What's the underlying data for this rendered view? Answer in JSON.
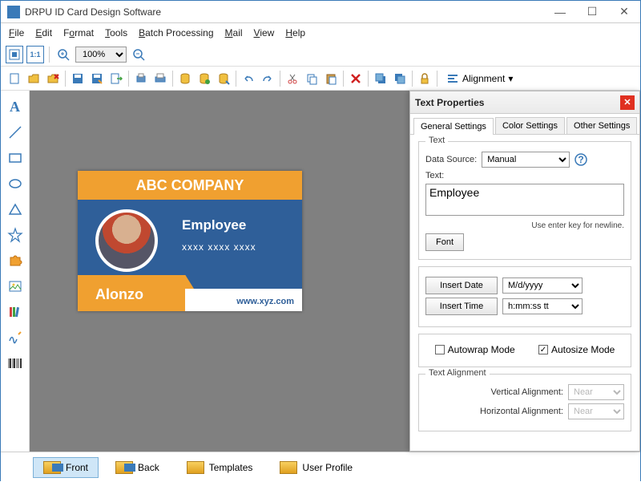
{
  "window": {
    "title": "DRPU ID Card Design Software"
  },
  "menu": [
    "File",
    "Edit",
    "Format",
    "Tools",
    "Batch Processing",
    "Mail",
    "View",
    "Help"
  ],
  "zoom": "100%",
  "alignment_label": "Alignment",
  "card": {
    "company": "ABC COMPANY",
    "role": "Employee",
    "masked": "xxxx xxxx xxxx",
    "name": "Alonzo",
    "website": "www.xyz.com"
  },
  "props": {
    "title": "Text Properties",
    "tabs": [
      "General Settings",
      "Color Settings",
      "Other Settings"
    ],
    "text_group": "Text",
    "data_source_label": "Data Source:",
    "data_source_value": "Manual",
    "text_label": "Text:",
    "text_value": "Employee",
    "font_btn": "Font",
    "hint": "Use enter key for newline.",
    "insert_date": "Insert Date",
    "date_fmt": "M/d/yyyy",
    "insert_time": "Insert Time",
    "time_fmt": "h:mm:ss tt",
    "autowrap": "Autowrap Mode",
    "autosize": "Autosize Mode",
    "align_group": "Text Alignment",
    "valign_label": "Vertical Alignment:",
    "halign_label": "Horizontal Alignment:",
    "align_value": "Near"
  },
  "bottom": {
    "front": "Front",
    "back": "Back",
    "templates": "Templates",
    "user_profile": "User Profile"
  }
}
